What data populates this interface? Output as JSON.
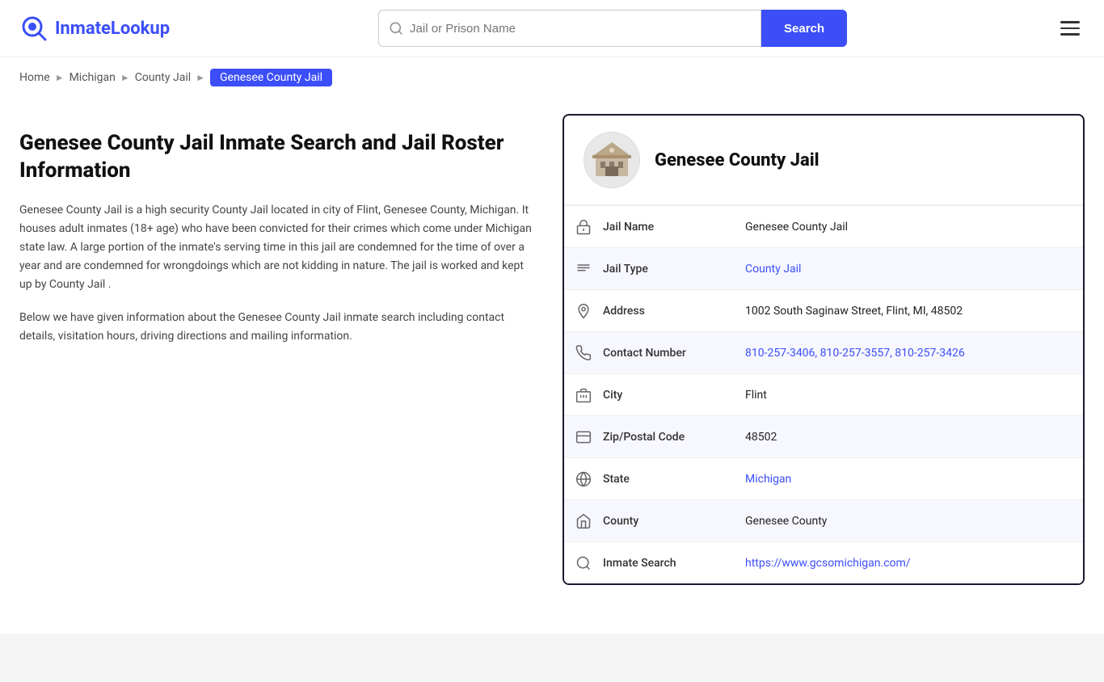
{
  "header": {
    "logo_text_part1": "Inmate",
    "logo_text_part2": "Lookup",
    "search_placeholder": "Jail or Prison Name",
    "search_button_label": "Search",
    "menu_label": "Menu"
  },
  "breadcrumb": {
    "items": [
      {
        "label": "Home",
        "href": "#"
      },
      {
        "label": "Michigan",
        "href": "#"
      },
      {
        "label": "County Jail",
        "href": "#"
      }
    ],
    "current": "Genesee County Jail"
  },
  "left": {
    "page_title": "Genesee County Jail Inmate Search and Jail Roster Information",
    "desc1": "Genesee County Jail is a high security County Jail located in city of Flint, Genesee County, Michigan. It houses adult inmates (18+ age) who have been convicted for their crimes which come under Michigan state law. A large portion of the inmate's serving time in this jail are condemned for the time of over a year and are condemned for wrongdoings which are not kidding in nature. The jail is worked and kept up by County Jail .",
    "desc2": "Below we have given information about the Genesee County Jail inmate search including contact details, visitation hours, driving directions and mailing information."
  },
  "card": {
    "title": "Genesee County Jail",
    "rows": [
      {
        "icon": "jail-icon",
        "label": "Jail Name",
        "value": "Genesee County Jail",
        "link": null
      },
      {
        "icon": "type-icon",
        "label": "Jail Type",
        "value": "County Jail",
        "link": "#"
      },
      {
        "icon": "address-icon",
        "label": "Address",
        "value": "1002 South Saginaw Street, Flint, MI, 48502",
        "link": null
      },
      {
        "icon": "phone-icon",
        "label": "Contact Number",
        "value": "810-257-3406, 810-257-3557, 810-257-3426",
        "link": "#"
      },
      {
        "icon": "city-icon",
        "label": "City",
        "value": "Flint",
        "link": null
      },
      {
        "icon": "zip-icon",
        "label": "Zip/Postal Code",
        "value": "48502",
        "link": null
      },
      {
        "icon": "state-icon",
        "label": "State",
        "value": "Michigan",
        "link": "#"
      },
      {
        "icon": "county-icon",
        "label": "County",
        "value": "Genesee County",
        "link": null
      },
      {
        "icon": "search-icon",
        "label": "Inmate Search",
        "value": "https://www.gcsomichigan.com/",
        "link": "https://www.gcsomichigan.com/"
      }
    ]
  }
}
